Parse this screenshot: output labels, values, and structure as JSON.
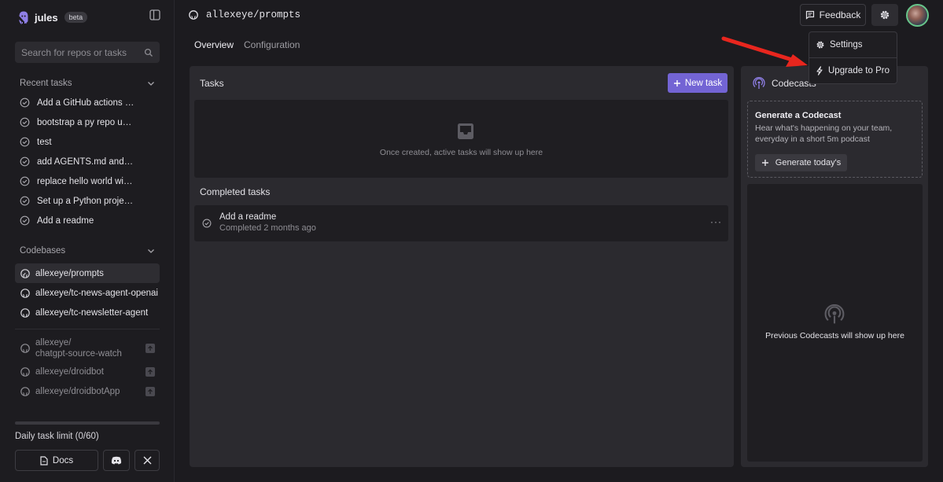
{
  "app": {
    "name": "jules",
    "badge": "beta"
  },
  "search": {
    "placeholder": "Search for repos or tasks"
  },
  "recent_tasks": {
    "header": "Recent tasks",
    "items": [
      "Add a GitHub actions wo...",
      "bootstrap a py repo usin...",
      "test",
      "add AGENTS.md and fill i...",
      "replace hello world with ...",
      "Set up a Python project ...",
      "Add a readme"
    ]
  },
  "codebases": {
    "header": "Codebases",
    "items": [
      "allexeye/prompts",
      "allexeye/tc-news-agent-openai",
      "allexeye/tc-newsletter-agent"
    ],
    "active_index": 0
  },
  "other_repos": [
    {
      "line1": "allexeye/",
      "line2": "chatgpt-source-watch"
    },
    {
      "line1": "allexeye/droidbot",
      "line2": ""
    },
    {
      "line1": "allexeye/droidbotApp",
      "line2": ""
    }
  ],
  "limit": {
    "label": "Daily task limit (0/60)",
    "used": 0,
    "total": 60
  },
  "footer": {
    "docs_label": "Docs"
  },
  "topbar": {
    "repo": "allexeye/prompts",
    "feedback_label": "Feedback"
  },
  "tabs": [
    {
      "label": "Overview",
      "active": true
    },
    {
      "label": "Configuration",
      "active": false
    }
  ],
  "tasks_panel": {
    "title": "Tasks",
    "new_task_label": "New task",
    "empty_message": "Once created, active tasks will show up here",
    "completed_header": "Completed tasks",
    "completed": [
      {
        "title": "Add a readme",
        "status": "Completed 2 months ago"
      }
    ]
  },
  "codecasts": {
    "title": "Codecasts",
    "generate_heading": "Generate a Codecast",
    "generate_desc": "Hear what's happening on your team, everyday in a short 5m podcast",
    "generate_button": "Generate today's",
    "previous_message": "Previous Codecasts will show up here"
  },
  "menu": {
    "items": [
      {
        "label": "Settings",
        "icon": "gear-icon"
      },
      {
        "label": "Upgrade to Pro",
        "icon": "lightning-icon"
      }
    ]
  },
  "colors": {
    "accent": "#7364d4",
    "annotation_arrow": "#e8261e"
  }
}
